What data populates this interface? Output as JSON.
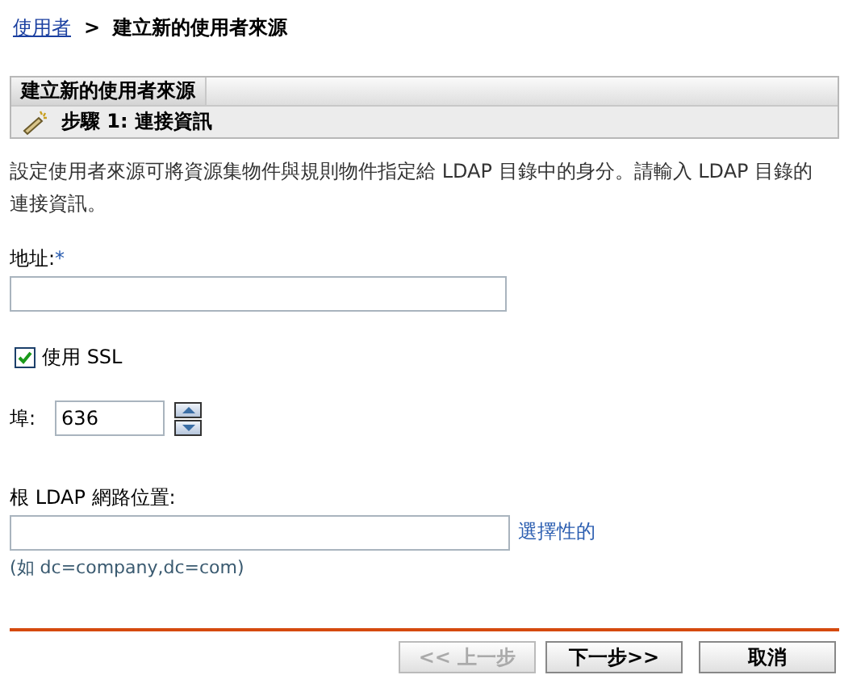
{
  "breadcrumb": {
    "link": "使用者",
    "separator": ">",
    "current": "建立新的使用者來源"
  },
  "panel": {
    "tab": "建立新的使用者來源",
    "step": "步驟 1: 連接資訊"
  },
  "description": "設定使用者來源可將資源集物件與規則物件指定給 LDAP 目錄中的身分。請輸入 LDAP 目錄的連接資訊。",
  "address": {
    "label": "地址:",
    "required_mark": "*"
  },
  "use_ssl": {
    "label": "使用 SSL",
    "checked": true
  },
  "port": {
    "label": "埠:",
    "value": "636"
  },
  "root": {
    "label": "根 LDAP 網路位置:",
    "optional": "選擇性的",
    "hint": "(如 dc=company,dc=com)"
  },
  "buttons": [
    {
      "label": "<< 上一步",
      "disabled": true
    },
    {
      "label": "下一步>>",
      "disabled": false
    },
    {
      "label": "取消",
      "disabled": false
    }
  ]
}
